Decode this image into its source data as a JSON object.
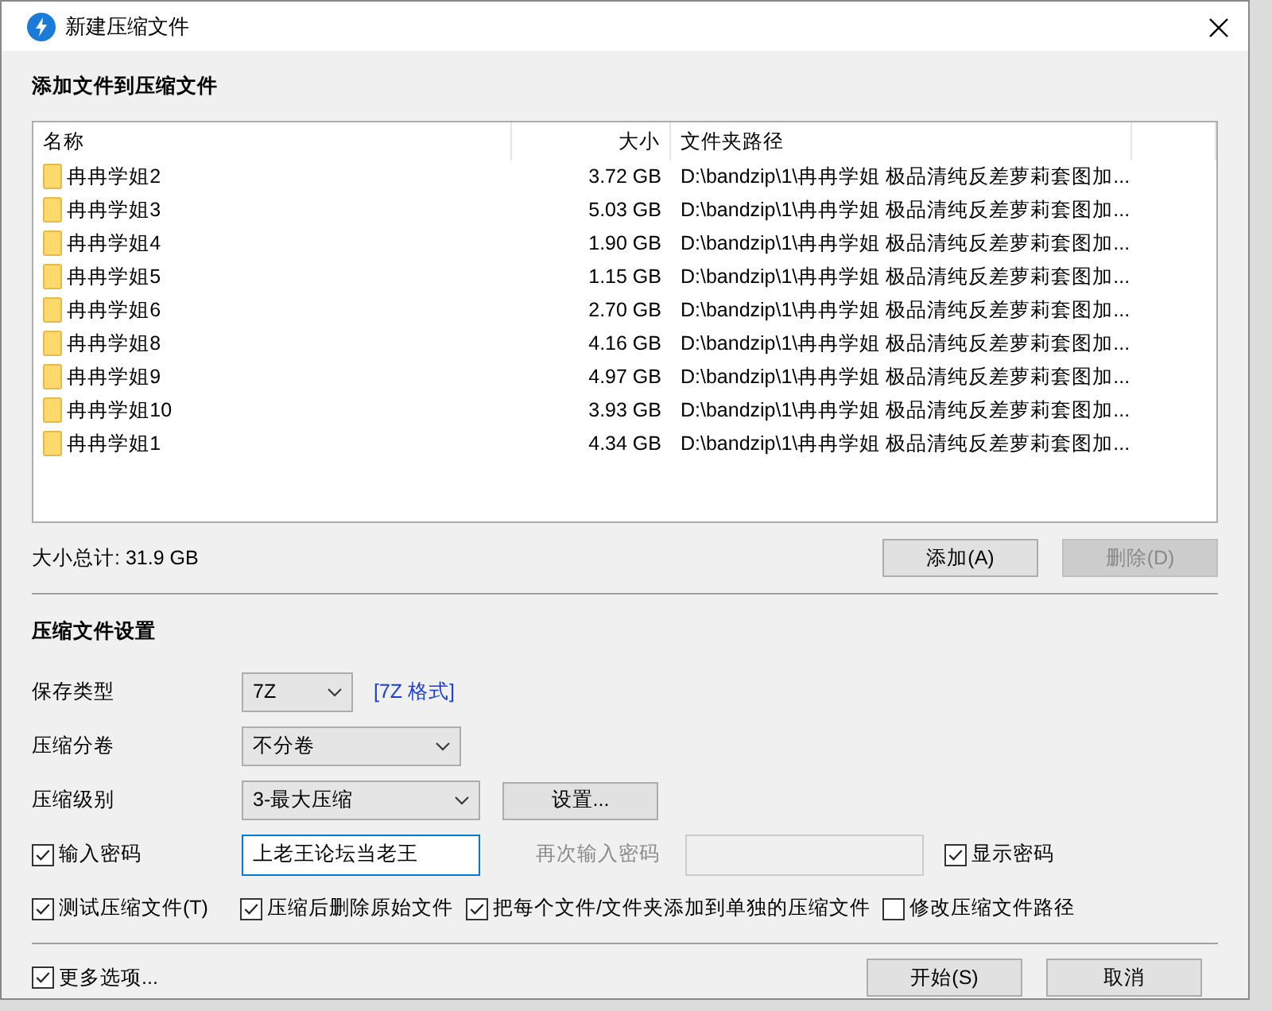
{
  "window": {
    "title": "新建压缩文件"
  },
  "files": {
    "heading": "添加文件到压缩文件",
    "columns": [
      "名称",
      "大小",
      "文件夹路径"
    ],
    "rows": [
      {
        "name": "冉冉学姐2",
        "size": "3.72 GB",
        "path": "D:\\bandzip\\1\\冉冉学姐 极品清纯反差萝莉套图加..."
      },
      {
        "name": "冉冉学姐3",
        "size": "5.03 GB",
        "path": "D:\\bandzip\\1\\冉冉学姐 极品清纯反差萝莉套图加..."
      },
      {
        "name": "冉冉学姐4",
        "size": "1.90 GB",
        "path": "D:\\bandzip\\1\\冉冉学姐 极品清纯反差萝莉套图加..."
      },
      {
        "name": "冉冉学姐5",
        "size": "1.15 GB",
        "path": "D:\\bandzip\\1\\冉冉学姐 极品清纯反差萝莉套图加..."
      },
      {
        "name": "冉冉学姐6",
        "size": "2.70 GB",
        "path": "D:\\bandzip\\1\\冉冉学姐 极品清纯反差萝莉套图加..."
      },
      {
        "name": "冉冉学姐8",
        "size": "4.16 GB",
        "path": "D:\\bandzip\\1\\冉冉学姐 极品清纯反差萝莉套图加..."
      },
      {
        "name": "冉冉学姐9",
        "size": "4.97 GB",
        "path": "D:\\bandzip\\1\\冉冉学姐 极品清纯反差萝莉套图加..."
      },
      {
        "name": "冉冉学姐10",
        "size": "3.93 GB",
        "path": "D:\\bandzip\\1\\冉冉学姐 极品清纯反差萝莉套图加..."
      },
      {
        "name": "冉冉学姐1",
        "size": "4.34 GB",
        "path": "D:\\bandzip\\1\\冉冉学姐 极品清纯反差萝莉套图加..."
      }
    ],
    "total": "大小总计: 31.9 GB",
    "buttons": [
      {
        "label": "添加(A)",
        "disabled": false
      },
      {
        "label": "删除(D)",
        "disabled": true
      }
    ]
  },
  "settings": {
    "heading": "压缩文件设置",
    "fields": [
      {
        "label": "保存类型",
        "value": "7Z",
        "link": "[7Z 格式]"
      },
      {
        "label": "压缩分卷",
        "value": "不分卷"
      },
      {
        "label": "压缩级别",
        "value": "3-最大压缩",
        "button": "设置..."
      }
    ],
    "password": {
      "label": "输入密码",
      "checked": true,
      "value": "上老王论坛当老王",
      "confirm_label": "再次输入密码",
      "confirm_disabled": true,
      "show_label": "显示密码",
      "show_checked": true
    },
    "options": [
      {
        "label": "测试压缩文件(T)",
        "checked": true
      },
      {
        "label": "压缩后删除原始文件",
        "checked": true
      },
      {
        "label": "把每个文件/文件夹添加到单独的压缩文件",
        "checked": true
      },
      {
        "label": "修改压缩文件路径",
        "checked": false
      }
    ]
  },
  "footer": {
    "more_options": {
      "label": "更多选项...",
      "checked": true
    },
    "buttons": [
      "开始(S)",
      "取消"
    ]
  }
}
